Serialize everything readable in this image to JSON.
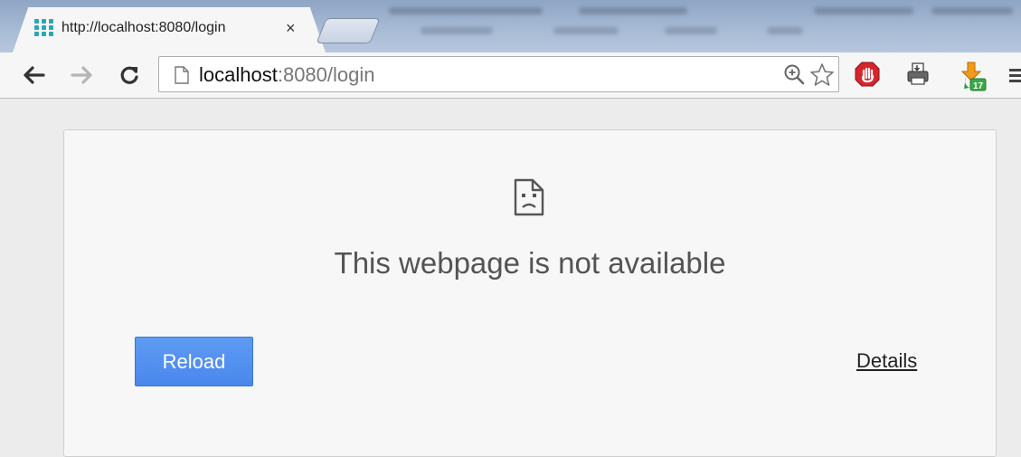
{
  "browser": {
    "tab": {
      "title": "http://localhost:8080/login",
      "close_label": "×"
    },
    "address_bar": {
      "url_host": "localhost",
      "url_rest": ":8080/login"
    },
    "icons": {
      "back": "arrow-left-icon",
      "forward": "arrow-right-icon",
      "reload": "reload-icon",
      "page": "page-icon",
      "zoom": "zoom-in-icon",
      "bookmark": "star-icon",
      "adblock": "adblock-stop-icon",
      "printer": "printer-icon",
      "download": "download-extension-icon",
      "menu": "hamburger-menu-icon"
    }
  },
  "error_page": {
    "headline": "This webpage is not available",
    "reload_label": "Reload",
    "details_label": "Details"
  },
  "colors": {
    "reload_button": "#4a87ec",
    "tabstrip": "#a9bcd6",
    "adblock_red": "#d6262b"
  }
}
